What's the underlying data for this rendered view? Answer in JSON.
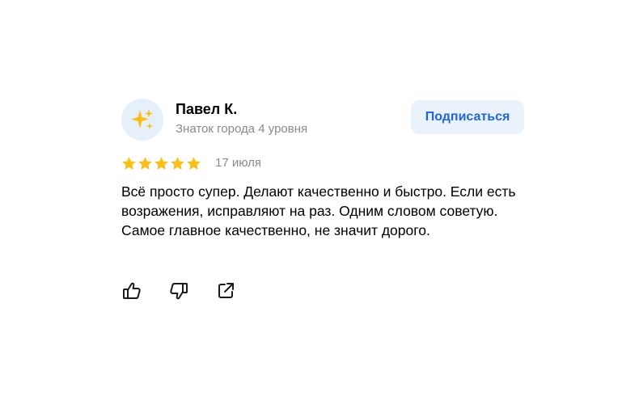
{
  "author": {
    "name": "Павел К.",
    "level": "Знаток города 4 уровня",
    "avatar_icon": "sparkles-icon"
  },
  "subscribe": {
    "label": "Подписаться"
  },
  "rating": {
    "value": 5,
    "max": 5,
    "color": "#fcbf15"
  },
  "date": "17 июля",
  "review_text": "Всё просто супер. Делают качественно и быстро. Если есть возражения, исправляют на раз. Одним словом советую. Самое главное качественно, не значит дорого.",
  "actions": {
    "like_icon": "thumbs-up-icon",
    "dislike_icon": "thumbs-down-icon",
    "share_icon": "share-icon"
  },
  "colors": {
    "accent": "#1f65e6",
    "button_bg": "#eaf2fc",
    "muted_text": "#8a8a8a",
    "avatar_bg": "#e6f0fa"
  }
}
